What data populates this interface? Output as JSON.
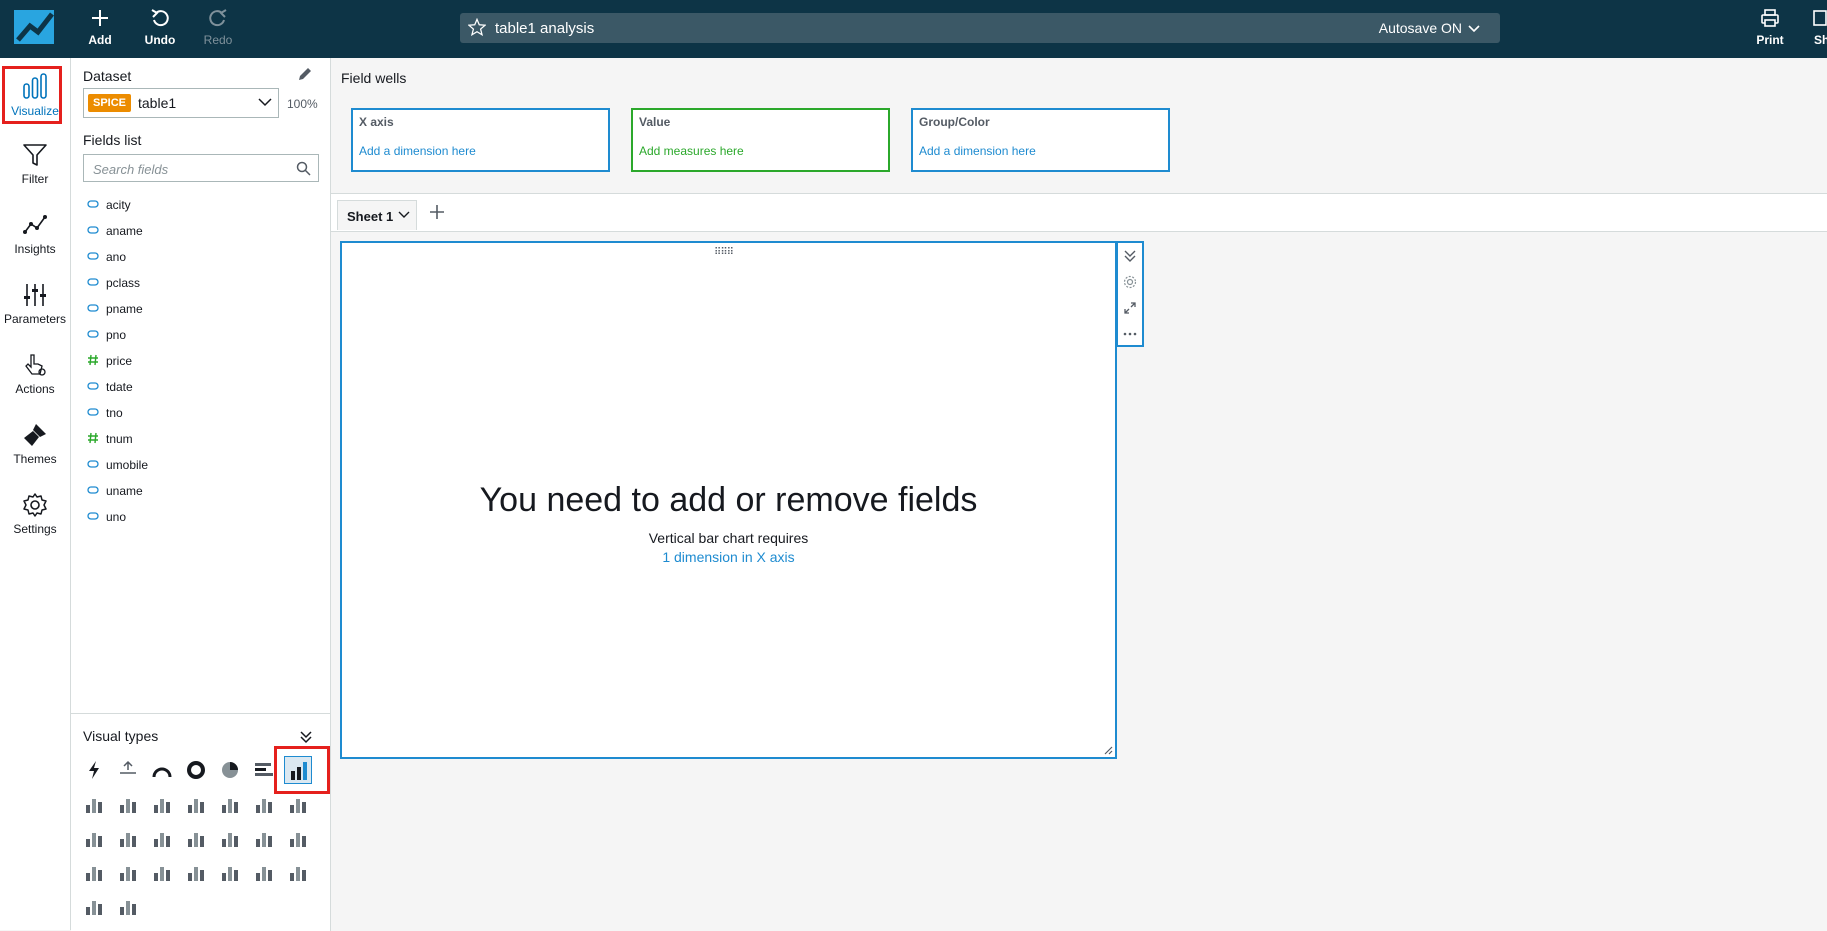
{
  "toolbar": {
    "add_label": "Add",
    "undo_label": "Undo",
    "redo_label": "Redo",
    "print_label": "Print",
    "share_label": "Sh"
  },
  "analysis": {
    "title": "table1 analysis",
    "autosave": "Autosave ON"
  },
  "nav": {
    "items": [
      {
        "label": "Visualize",
        "icon": "bar-chart-icon",
        "active": true
      },
      {
        "label": "Filter",
        "icon": "filter-icon"
      },
      {
        "label": "Insights",
        "icon": "insights-icon"
      },
      {
        "label": "Parameters",
        "icon": "sliders-icon"
      },
      {
        "label": "Actions",
        "icon": "pointer-icon"
      },
      {
        "label": "Themes",
        "icon": "paintbrush-icon"
      },
      {
        "label": "Settings",
        "icon": "gear-icon"
      }
    ]
  },
  "dataset": {
    "label": "Dataset",
    "badge": "SPICE",
    "name": "table1",
    "percent": "100%"
  },
  "fields": {
    "label": "Fields list",
    "search_placeholder": "Search fields",
    "items": [
      {
        "name": "acity",
        "type": "dimension"
      },
      {
        "name": "aname",
        "type": "dimension"
      },
      {
        "name": "ano",
        "type": "dimension"
      },
      {
        "name": "pclass",
        "type": "dimension"
      },
      {
        "name": "pname",
        "type": "dimension"
      },
      {
        "name": "pno",
        "type": "dimension"
      },
      {
        "name": "price",
        "type": "measure"
      },
      {
        "name": "tdate",
        "type": "dimension"
      },
      {
        "name": "tno",
        "type": "dimension"
      },
      {
        "name": "tnum",
        "type": "measure"
      },
      {
        "name": "umobile",
        "type": "dimension"
      },
      {
        "name": "uname",
        "type": "dimension"
      },
      {
        "name": "uno",
        "type": "dimension"
      }
    ]
  },
  "visual_types": {
    "label": "Visual types",
    "selected": "vertical-bar-chart"
  },
  "field_wells": {
    "title": "Field wells",
    "wells": [
      {
        "title": "X axis",
        "placeholder": "Add a dimension here"
      },
      {
        "title": "Value",
        "placeholder": "Add measures here"
      },
      {
        "title": "Group/Color",
        "placeholder": "Add a dimension here"
      }
    ]
  },
  "sheets": {
    "tabs": [
      {
        "label": "Sheet 1"
      }
    ]
  },
  "visual": {
    "message": "You need to add or remove fields",
    "subtitle": "Vertical bar chart requires",
    "requirement": "1 dimension in X axis"
  },
  "colors": {
    "topbar": "#0d3446",
    "accent": "#1e8bd0",
    "measure": "#2ba82b",
    "spice": "#ec8c00",
    "highlight": "#e5201d"
  }
}
